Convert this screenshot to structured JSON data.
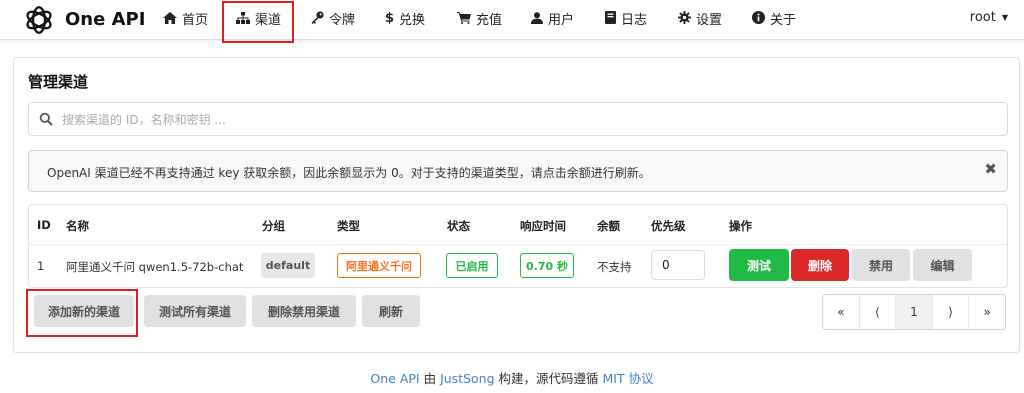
{
  "header": {
    "brand": "One API",
    "nav": [
      {
        "label": "首页",
        "icon": "home-icon"
      },
      {
        "label": "渠道",
        "icon": "sitemap-icon"
      },
      {
        "label": "令牌",
        "icon": "key-icon"
      },
      {
        "label": "兑换",
        "icon": "dollar-icon"
      },
      {
        "label": "充值",
        "icon": "cart-icon"
      },
      {
        "label": "用户",
        "icon": "user-icon"
      },
      {
        "label": "日志",
        "icon": "book-icon"
      },
      {
        "label": "设置",
        "icon": "gear-icon"
      },
      {
        "label": "关于",
        "icon": "info-icon"
      }
    ],
    "user": "root"
  },
  "page": {
    "title": "管理渠道",
    "search_placeholder": "搜索渠道的 ID，名称和密钥 ...",
    "notice": "OpenAI 渠道已经不再支持通过 key 获取余额，因此余额显示为 0。对于支持的渠道类型，请点击余额进行刷新。",
    "notice_close": "✖"
  },
  "table": {
    "headers": [
      "ID",
      "名称",
      "分组",
      "类型",
      "状态",
      "响应时间",
      "余额",
      "优先级",
      "操作"
    ],
    "rows": [
      {
        "id": "1",
        "name": "阿里通义千问 qwen1.5-72b-chat",
        "group": "default",
        "type": "阿里通义千问",
        "status": "已启用",
        "response_time": "0.70 秒",
        "balance": "不支持",
        "priority": "0",
        "actions": {
          "test": "测试",
          "delete": "删除",
          "disable": "禁用",
          "edit": "编辑"
        }
      }
    ]
  },
  "toolbar": {
    "add": "添加新的渠道",
    "test_all": "测试所有渠道",
    "delete_disabled": "删除禁用渠道",
    "refresh": "刷新"
  },
  "pagination": {
    "first": "«",
    "prev": "⟨",
    "current": "1",
    "next": "⟩",
    "last": "»"
  },
  "footer": {
    "part1": "One API",
    "part2": " 由 ",
    "part3": "JustSong",
    "part4": " 构建，源代码遵循 ",
    "part5": "MIT 协议"
  },
  "colors": {
    "highlight": "#e02020",
    "green": "#21ba45",
    "red": "#db2828",
    "orange": "#f2711c",
    "link": "#4183c4"
  }
}
